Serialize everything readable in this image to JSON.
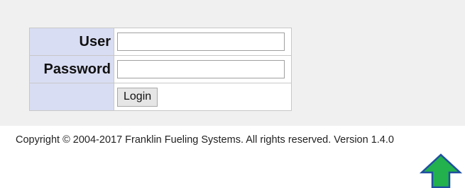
{
  "login": {
    "user_label": "User",
    "user_value": "",
    "password_label": "Password",
    "password_value": "",
    "login_button_label": "Login"
  },
  "footer": {
    "copyright": "Copyright © 2004-2017 Franklin Fueling Systems. All rights reserved. Version 1.4.0"
  },
  "annotation": {
    "arrow_icon": "up-arrow-icon",
    "arrow_color": "#22b14c",
    "arrow_outline": "#1f4fa0"
  },
  "colors": {
    "panel_background": "#f0f0f0",
    "label_background": "#d9ddf3"
  }
}
